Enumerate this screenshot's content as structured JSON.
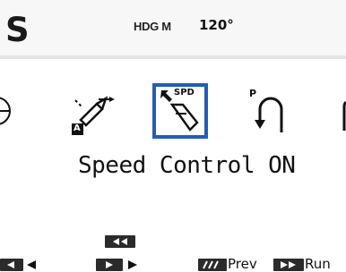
{
  "header": {
    "mode_letter": "S",
    "heading_label": "HDG M",
    "heading_value": "120°"
  },
  "modes": [
    {
      "name": "circle-partial",
      "label": ""
    },
    {
      "name": "nav-track",
      "label": "A"
    },
    {
      "name": "speed-control",
      "label": "SPD",
      "selected": true
    },
    {
      "name": "u-turn",
      "label": "P"
    },
    {
      "name": "partial-right",
      "label": ""
    }
  ],
  "status": {
    "text": "Speed Control ON"
  },
  "softkeys": {
    "prev_label": "Prev",
    "run_label": "Run"
  },
  "colors": {
    "selection": "#1f5fb8",
    "keycap": "#2b2b2b"
  }
}
